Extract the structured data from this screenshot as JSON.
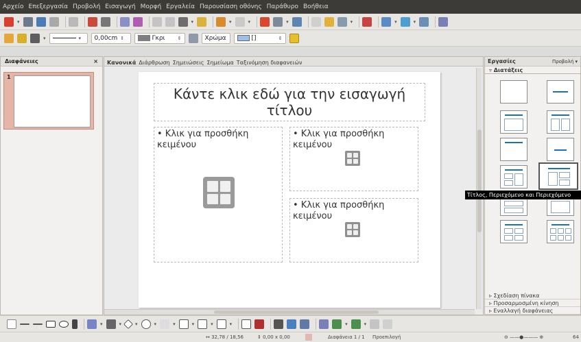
{
  "menu": [
    "Αρχείο",
    "Επεξεργασία",
    "Προβολή",
    "Εισαγωγή",
    "Μορφή",
    "Εργαλεία",
    "Παρουσίαση οθόνης",
    "Παράθυρο",
    "Βοήθεια"
  ],
  "line_toolbar": {
    "line_width": "0,00cm",
    "fill_color_name": "Γκρι",
    "area_style": "Χρώμα",
    "swatch_color": "#7f7f7f"
  },
  "slides_panel": {
    "title": "Διαφάνειες",
    "close": "×",
    "thumbnails": [
      {
        "number": "1"
      }
    ]
  },
  "view_tabs": [
    "Κανονικά",
    "Διάρθρωση",
    "Σημειώσεις",
    "Σημείωμα",
    "Ταξινόμηση διαφανειών"
  ],
  "active_view_tab": "Κανονικά",
  "slide": {
    "title_placeholder": "Κάντε κλικ εδώ για την εισαγωγή τίτλου",
    "content_left": "• Κλικ για προσθήκη κειμένου",
    "content_right_top": "• Κλικ για προσθήκη κειμένου",
    "content_right_bottom": "• Κλικ για προσθήκη κειμένου"
  },
  "tasks_panel": {
    "title": "Εργασίες",
    "view_menu": "Προβολή ▾",
    "open_section": "▿ Διατάξεις",
    "tooltip": "Τίτλος, Περιεχόμενο και Περιεχόμενο",
    "collapsed_sections": [
      "▹ Σχεδίαση πίνακα",
      "▹ Προσαρμοσμένη κίνηση",
      "▹ Εναλλαγή διαφάνειας"
    ]
  },
  "status": {
    "position": "32,78 / 18,56",
    "size": "0,00 x 0,00",
    "slide": "Διαφάνεια 1 / 1",
    "master": "Προεπιλογή",
    "zoom": "64"
  },
  "colors": {
    "menubar": "#3c3b37",
    "accent_blue": "#1e6fb0",
    "thumbnail_selection": "#e5b5a8"
  }
}
